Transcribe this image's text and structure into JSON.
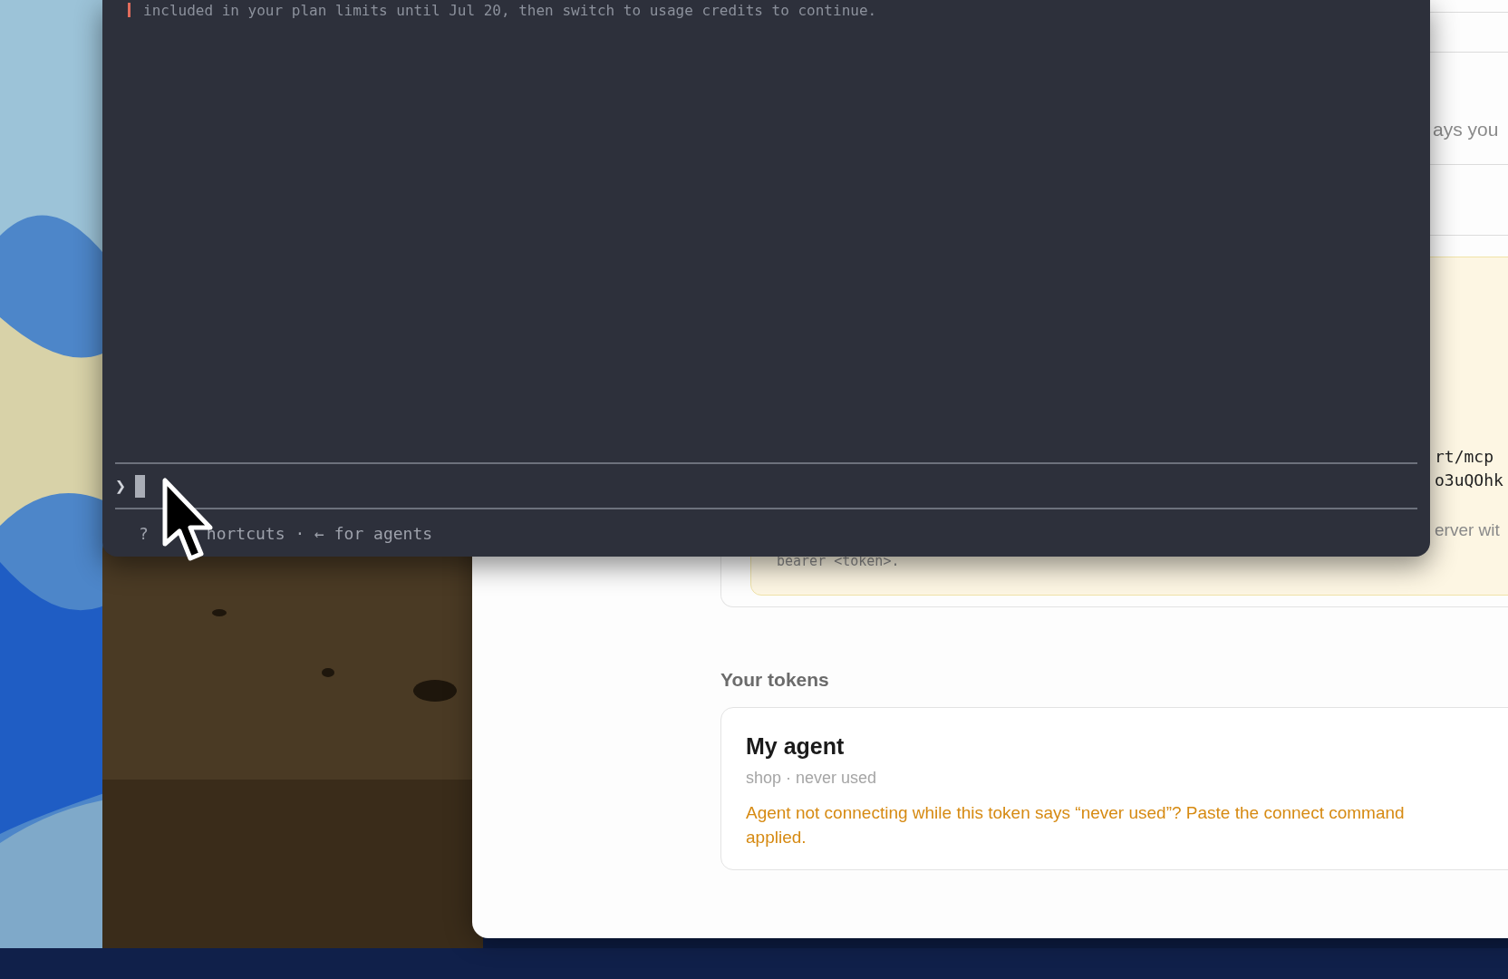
{
  "terminal": {
    "notice": "included in your plan limits until Jul 20, then switch to usage credits to continue.",
    "prompt": "❯",
    "footer_key": "?",
    "footer_hint": "hortcuts · ← for agents"
  },
  "page": {
    "setting_fragment": "ays you",
    "code_lines": [
      "rt/mcp",
      "o3uQOhk"
    ],
    "note_fragment": "erver wit",
    "code_tail": "bearer <token>.",
    "tokens_heading": "Your tokens",
    "tokens": [
      {
        "name": "My agent",
        "meta": "shop · never used",
        "hint_lines": [
          "Agent not connecting while this token says “never used”? Paste the connect command",
          "applied."
        ]
      }
    ]
  }
}
